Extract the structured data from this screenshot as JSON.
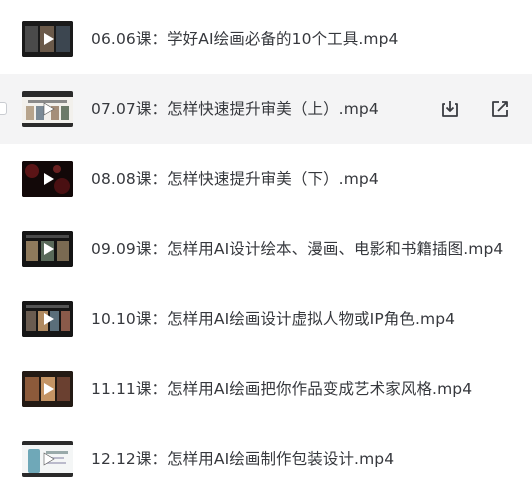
{
  "files": [
    {
      "title": "06.06课：学好AI绘画必备的10个工具.mp4",
      "thumb": "dark-collage",
      "hovered": false
    },
    {
      "title": "07.07课：怎样快速提升审美（上）.mp4",
      "thumb": "light-slide",
      "hovered": true
    },
    {
      "title": "08.08课：怎样快速提升审美（下）.mp4",
      "thumb": "dark-red",
      "hovered": false
    },
    {
      "title": "09.09课：怎样用AI设计绘本、漫画、电影和书籍插图.mp4",
      "thumb": "dark-panels",
      "hovered": false
    },
    {
      "title": "10.10课：怎样用AI绘画设计虚拟人物或IP角色.mp4",
      "thumb": "dark-characters",
      "hovered": false
    },
    {
      "title": "11.11课：怎样用AI绘画把你作品变成艺术家风格.mp4",
      "thumb": "dark-art",
      "hovered": false
    },
    {
      "title": "12.12课：怎样用AI绘画制作包装设计.mp4",
      "thumb": "light-package",
      "hovered": false
    }
  ],
  "actions": {
    "download_icon": "download-icon",
    "open_icon": "open-external-icon"
  },
  "colors": {
    "hover_bg": "#f4f4f5",
    "text": "#36383d",
    "icon": "#3a3c41"
  }
}
